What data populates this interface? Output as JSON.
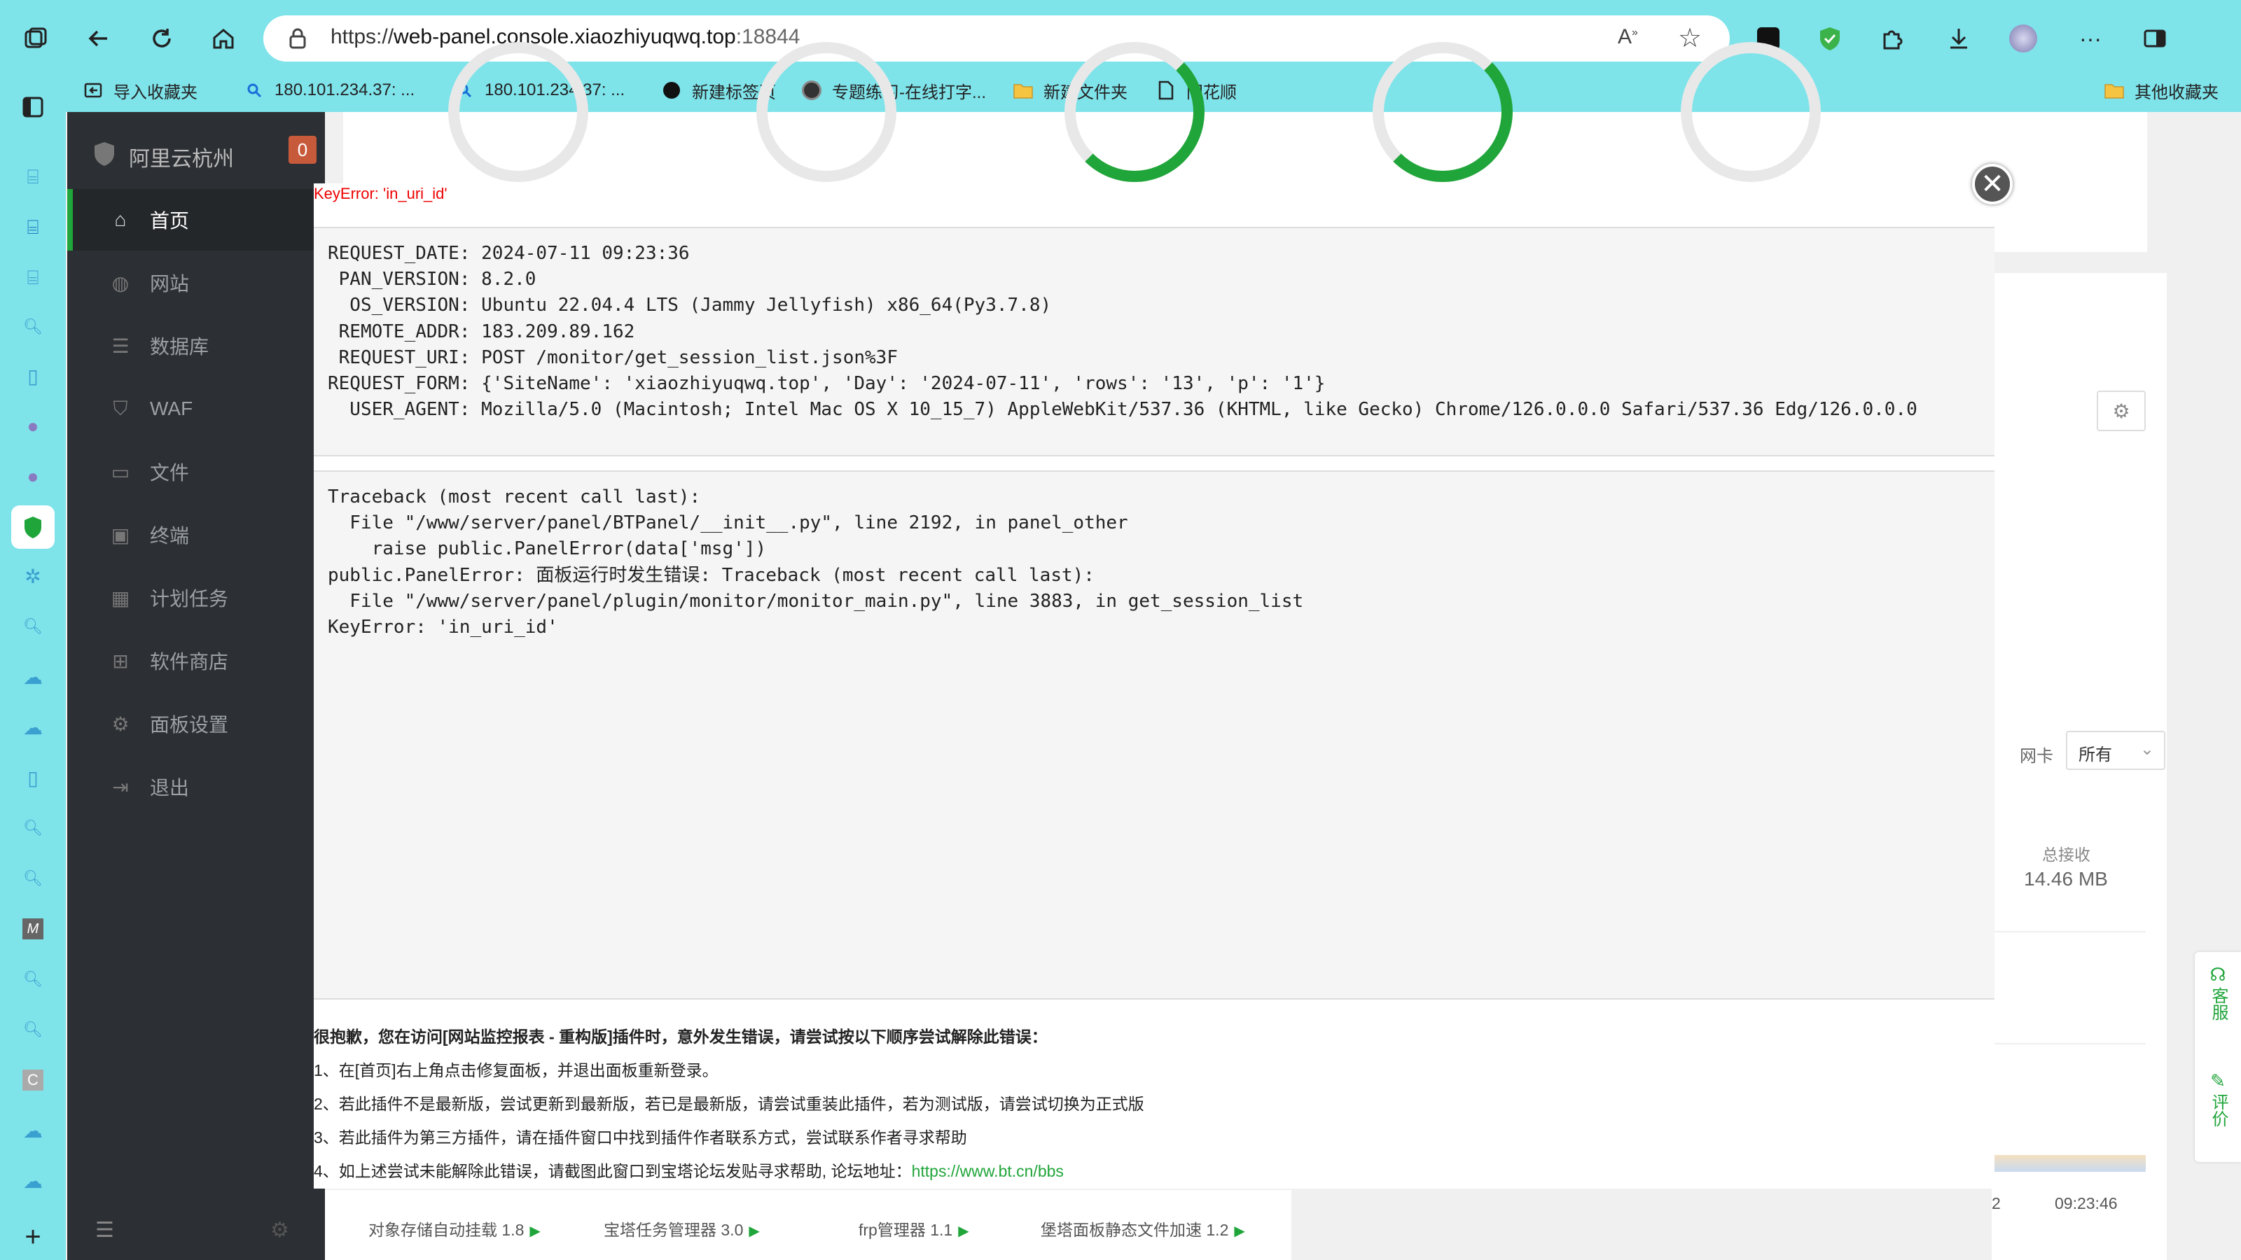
{
  "browser": {
    "url_scheme": "https://",
    "url_host": "web-panel.console.xiaozhiyuqwq.top",
    "url_port": ":18844",
    "bookmarks": [
      {
        "label": "导入收藏夹",
        "icon": "import-icon"
      },
      {
        "label": "180.101.234.37: ...",
        "icon": "search-icon"
      },
      {
        "label": "180.101.234.37: ...",
        "icon": "search-icon"
      },
      {
        "label": "新建标签页",
        "icon": "circle-icon"
      },
      {
        "label": "专题练习-在线打字...",
        "icon": "globe-icon"
      },
      {
        "label": "新建文件夹",
        "icon": "folder-icon"
      },
      {
        "label": "同花顺",
        "icon": "page-icon"
      }
    ],
    "other_bookmarks": "其他收藏夹"
  },
  "panel": {
    "brand": "阿里云杭州",
    "badge": "0",
    "nav": [
      {
        "label": "首页",
        "icon": "home-icon"
      },
      {
        "label": "网站",
        "icon": "globe-icon"
      },
      {
        "label": "数据库",
        "icon": "database-icon"
      },
      {
        "label": "WAF",
        "icon": "shield-icon"
      },
      {
        "label": "文件",
        "icon": "folder-icon"
      },
      {
        "label": "终端",
        "icon": "terminal-icon"
      },
      {
        "label": "计划任务",
        "icon": "calendar-icon"
      },
      {
        "label": "软件商店",
        "icon": "grid-icon"
      },
      {
        "label": "面板设置",
        "icon": "gear-icon"
      },
      {
        "label": "退出",
        "icon": "logout-icon"
      }
    ],
    "net_card_label": "网卡",
    "net_card_value": "所有",
    "total_recv_label": "总接收",
    "total_recv_value": "14.46 MB",
    "chart_time": "09:23:46",
    "chart_time_left": "2",
    "plugins": [
      "对象存储自动挂载 1.8",
      "宝塔任务管理器 3.0",
      "frp管理器 1.1",
      "堡塔面板静态文件加速 1.2"
    ],
    "float_service": "客服",
    "float_review": "评价"
  },
  "dialog": {
    "error_title": "KeyError: 'in_uri_id'",
    "info_lines": [
      "REQUEST_DATE: 2024-07-11 09:23:36",
      " PAN_VERSION: 8.2.0",
      "  OS_VERSION: Ubuntu 22.04.4 LTS (Jammy Jellyfish) x86_64(Py3.7.8)",
      " REMOTE_ADDR: 183.209.89.162",
      " REQUEST_URI: POST /monitor/get_session_list.json%3F",
      "REQUEST_FORM: {'SiteName': 'xiaozhiyuqwq.top', 'Day': '2024-07-11', 'rows': '13', 'p': '1'}",
      "  USER_AGENT: Mozilla/5.0 (Macintosh; Intel Mac OS X 10_15_7) AppleWebKit/537.36 (KHTML, like Gecko) Chrome/126.0.0.0 Safari/537.36 Edg/126.0.0.0"
    ],
    "trace_lines": [
      "Traceback (most recent call last):",
      "  File \"/www/server/panel/BTPanel/__init__.py\", line 2192, in panel_other",
      "    raise public.PanelError(data['msg'])",
      "public.PanelError: 面板运行时发生错误: Traceback (most recent call last):",
      "  File \"/www/server/panel/plugin/monitor/monitor_main.py\", line 3883, in get_session_list",
      "KeyError: 'in_uri_id'"
    ],
    "help_title": "很抱歉，您在访问[网站监控报表 - 重构版]插件时，意外发生错误，请尝试按以下顺序尝试解除此错误：",
    "help_lines": [
      "1、在[首页]右上角点击修复面板，并退出面板重新登录。",
      "2、若此插件不是最新版，尝试更新到最新版，若已是最新版，请尝试重装此插件，若为测试版，请尝试切换为正式版",
      "3、若此插件为第三方插件，请在插件窗口中找到插件作者联系方式，尝试联系作者寻求帮助"
    ],
    "help_last_prefix": "4、如上述尝试未能解除此错误，请截图此窗口到宝塔论坛发贴寻求帮助, 论坛地址：",
    "help_link": "https://www.bt.cn/bbs"
  },
  "colors": {
    "accent": "#20a53a",
    "browser_chrome": "#7fe3ea",
    "sidebar": "#2c2f33",
    "error": "#e00000"
  }
}
